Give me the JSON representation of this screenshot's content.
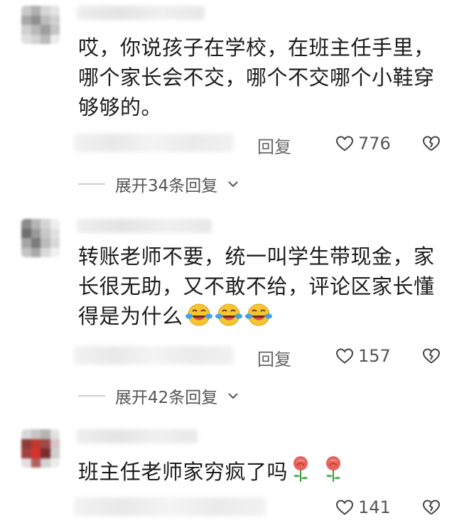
{
  "comments": [
    {
      "text_lines": [
        "哎，你说孩子在学校，在班主任手里，",
        "哪个家长会不交，哪个不交哪个小鞋穿",
        "够够的。"
      ],
      "reply_label": "回复",
      "like_count": "776",
      "expand_label": "展开34条回复",
      "avatar_colors": [
        "#c9c9c9",
        "#b0b0b0",
        "#d6d6d6",
        "#e3e3e3",
        "#a8a8a8",
        "#8f8f8f",
        "#bdbdbd",
        "#d0d0d0",
        "#cfcfcf",
        "#b8b8b8",
        "#9e9e9e",
        "#c4c4c4",
        "#e0e0e0",
        "#d2d2d2",
        "#bababa",
        "#ececec"
      ],
      "like_icon": "heart-outline-icon",
      "dislike_icon": "broken-heart-icon"
    },
    {
      "text_lines": [
        "转账老师不要，统一叫学生带现金，家",
        "长很无助，又不敢不给，评论区家长懂",
        "得是为什么"
      ],
      "emoji": [
        "laughing-tears-emoji",
        "laughing-tears-emoji",
        "laughing-tears-emoji"
      ],
      "reply_label": "回复",
      "like_count": "157",
      "expand_label": "展开42条回复",
      "avatar_colors": [
        "#8a8a8a",
        "#b5b5b5",
        "#d4d4d4",
        "#eeeeee",
        "#6f6f6f",
        "#9a9a9a",
        "#c8c8c8",
        "#e0e0e0",
        "#a5a5a5",
        "#7c7c7c",
        "#bcbcbc",
        "#d9d9d9",
        "#c3c3c3",
        "#a9a9a9",
        "#dadada",
        "#f0f0f0"
      ],
      "like_icon": "heart-outline-icon",
      "dislike_icon": "broken-heart-icon"
    },
    {
      "text_lines": [
        "班主任老师家穷疯了吗"
      ],
      "emoji": [
        "rose-emoji",
        "rose-emoji"
      ],
      "like_count": "141",
      "avatar_colors": [
        "#d9d9d9",
        "#c7c7c7",
        "#b5b5b5",
        "#e2e2e2",
        "#8c3b3b",
        "#c0392b",
        "#9e4a4a",
        "#d6c6c6",
        "#a34040",
        "#d93030",
        "#7a2d2d",
        "#cfcfcf",
        "#e5dede",
        "#b06060",
        "#d2d2d2",
        "#ececec"
      ],
      "like_icon": "heart-outline-icon",
      "dislike_icon": "broken-heart-icon"
    }
  ]
}
